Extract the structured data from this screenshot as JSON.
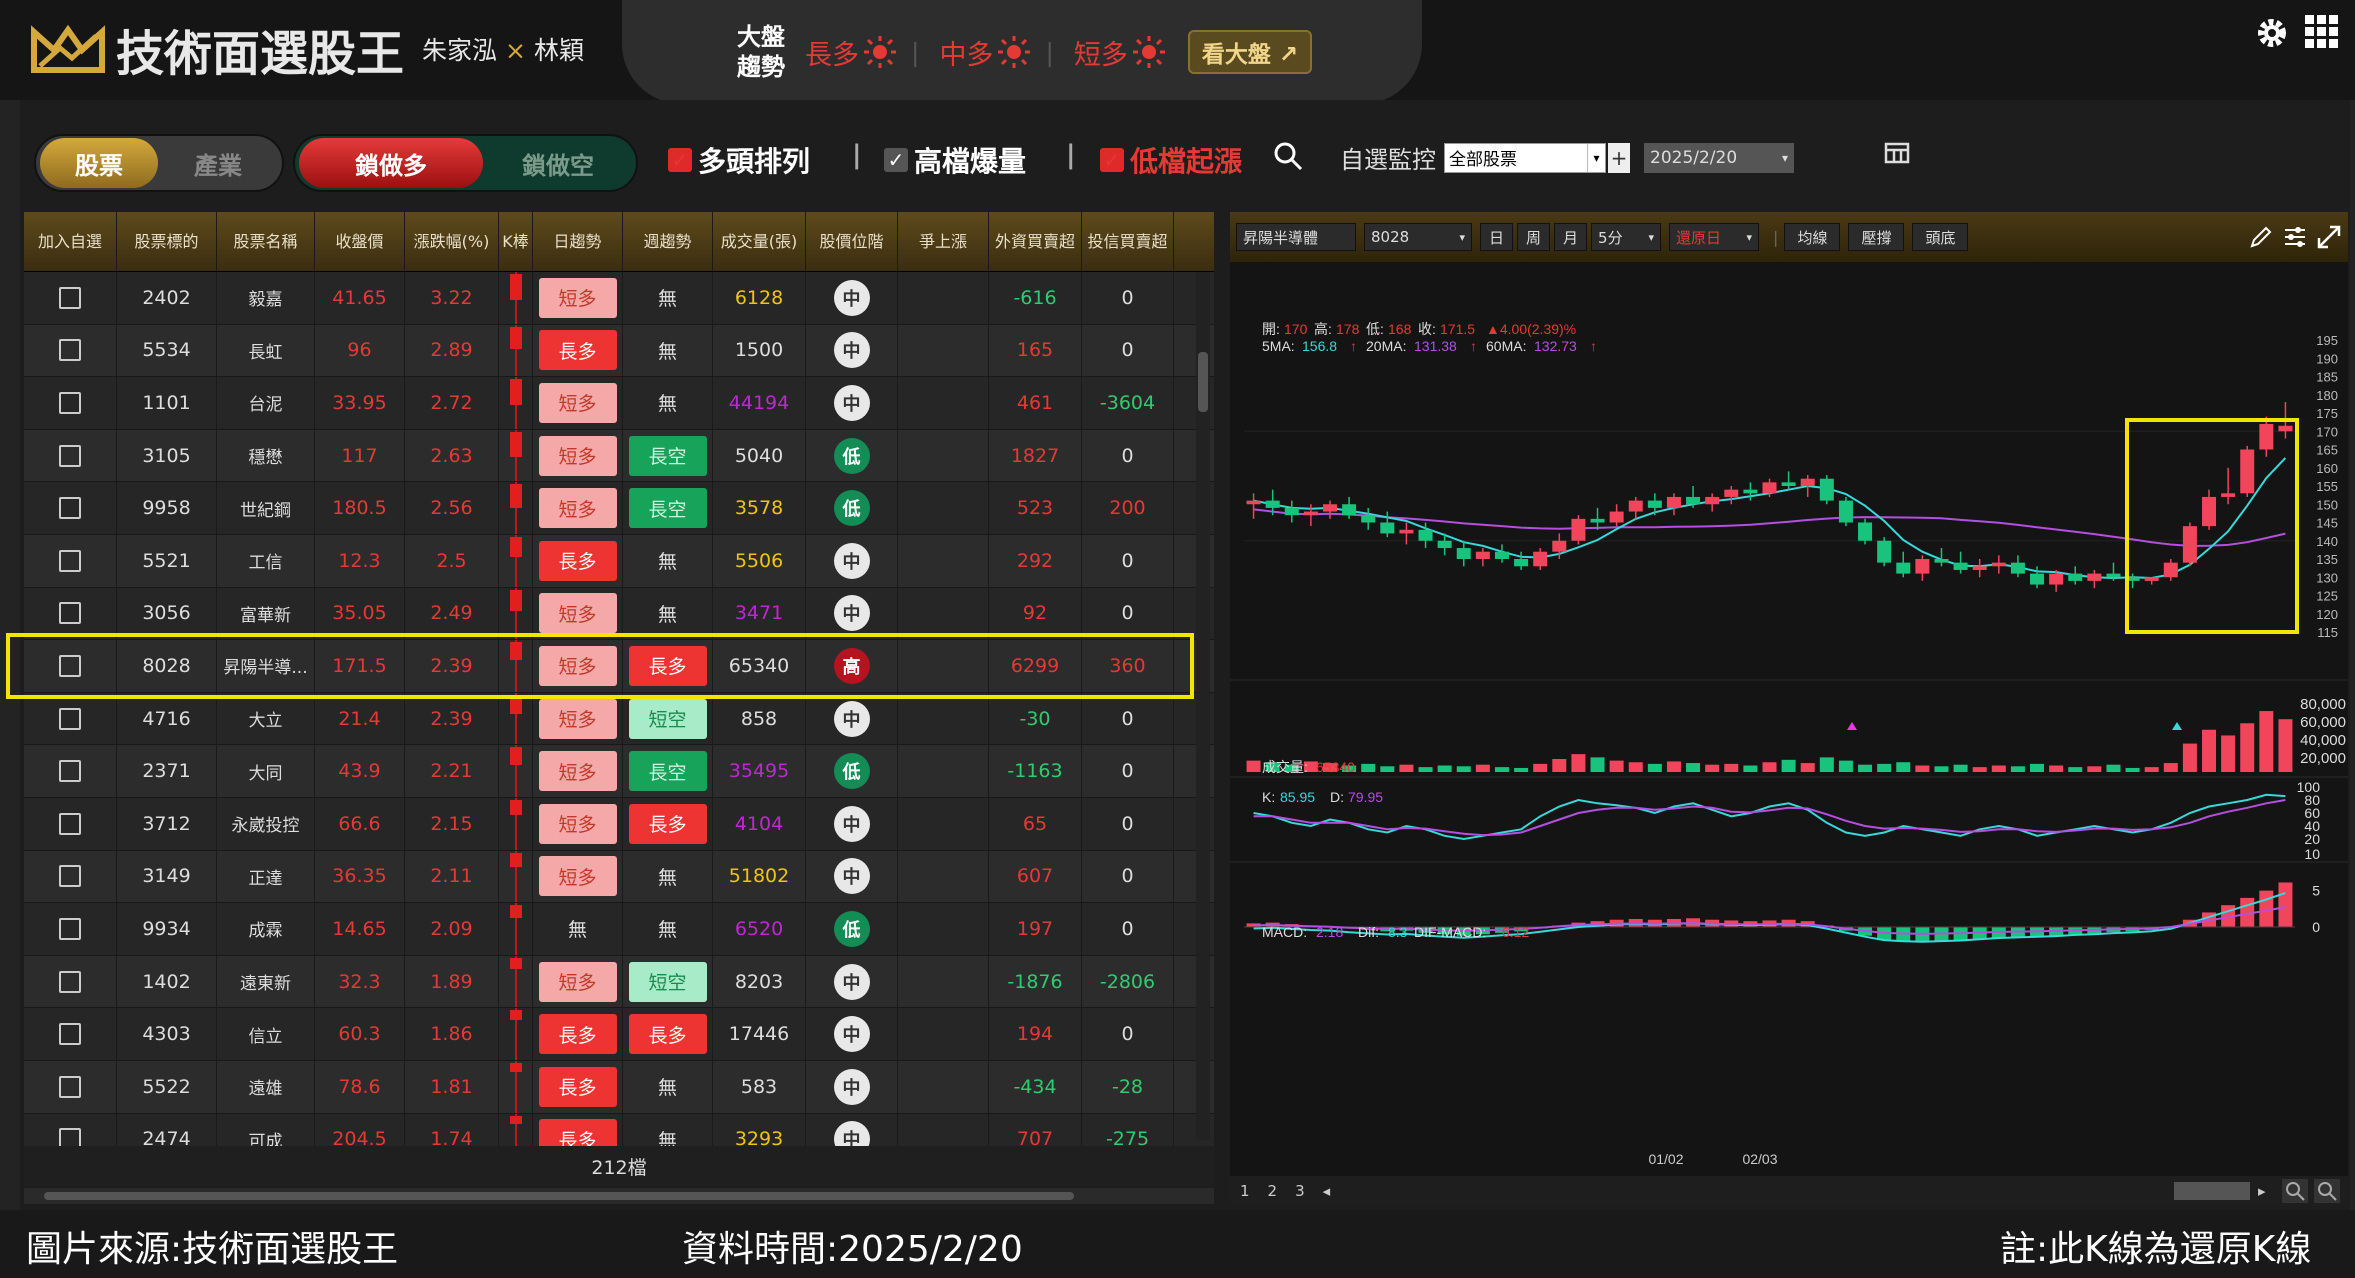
{
  "app": {
    "title": "技術面選股王",
    "author_a": "朱家泓",
    "author_sep": "×",
    "author_b": "林穎"
  },
  "market": {
    "label_line1": "大盤",
    "label_line2": "趨勢",
    "long": "長多",
    "mid": "中多",
    "short": "短多",
    "view_button": "看大盤"
  },
  "filters": {
    "tab_stock": "股票",
    "tab_industry": "產業",
    "lock_long": "鎖做多",
    "lock_short": "鎖做空",
    "opt1": "多頭排列",
    "opt2": "高檔爆量",
    "opt3": "低檔起漲",
    "watch_label": "自選監控",
    "watch_value": "全部股票",
    "date_value": "2025/2/20"
  },
  "table": {
    "headers": [
      "加入自選",
      "股票標的",
      "股票名稱",
      "收盤價",
      "漲跌幅(%)",
      "K棒",
      "日趨勢",
      "週趨勢",
      "成交量(張)",
      "股價位階",
      "爭上漲",
      "外資買賣超",
      "投信買賣超"
    ],
    "rows": [
      {
        "code": "2402",
        "name": "毅嘉",
        "close": "41.65",
        "chg": "3.22",
        "day": "短多",
        "week": "無",
        "vol": "6128",
        "volc": "yellow",
        "pos": "中",
        "fi": "-616",
        "fic": "green",
        "it": "0",
        "itc": "white"
      },
      {
        "code": "5534",
        "name": "長虹",
        "close": "96",
        "chg": "2.89",
        "day": "長多",
        "week": "無",
        "vol": "1500",
        "volc": "white",
        "pos": "中",
        "fi": "165",
        "fic": "red",
        "it": "0",
        "itc": "white"
      },
      {
        "code": "1101",
        "name": "台泥",
        "close": "33.95",
        "chg": "2.72",
        "day": "短多",
        "week": "無",
        "vol": "44194",
        "volc": "purple",
        "pos": "中",
        "fi": "461",
        "fic": "red",
        "it": "-3604",
        "itc": "green"
      },
      {
        "code": "3105",
        "name": "穩懋",
        "close": "117",
        "chg": "2.63",
        "day": "短多",
        "week": "長空",
        "vol": "5040",
        "volc": "white",
        "pos": "低",
        "fi": "1827",
        "fic": "red",
        "it": "0",
        "itc": "white"
      },
      {
        "code": "9958",
        "name": "世紀鋼",
        "close": "180.5",
        "chg": "2.56",
        "day": "短多",
        "week": "長空",
        "vol": "3578",
        "volc": "yellow",
        "pos": "低",
        "fi": "523",
        "fic": "red",
        "it": "200",
        "itc": "red"
      },
      {
        "code": "5521",
        "name": "工信",
        "close": "12.3",
        "chg": "2.5",
        "day": "長多",
        "week": "無",
        "vol": "5506",
        "volc": "yellow",
        "pos": "中",
        "fi": "292",
        "fic": "red",
        "it": "0",
        "itc": "white"
      },
      {
        "code": "3056",
        "name": "富華新",
        "close": "35.05",
        "chg": "2.49",
        "day": "短多",
        "week": "無",
        "vol": "3471",
        "volc": "purple",
        "pos": "中",
        "fi": "92",
        "fic": "red",
        "it": "0",
        "itc": "white"
      },
      {
        "code": "8028",
        "name": "昇陽半導...",
        "close": "171.5",
        "chg": "2.39",
        "day": "短多",
        "week": "長多",
        "vol": "65340",
        "volc": "white",
        "pos": "高",
        "fi": "6299",
        "fic": "red",
        "it": "360",
        "itc": "red"
      },
      {
        "code": "4716",
        "name": "大立",
        "close": "21.4",
        "chg": "2.39",
        "day": "短多",
        "week": "短空",
        "vol": "858",
        "volc": "white",
        "pos": "中",
        "fi": "-30",
        "fic": "green",
        "it": "0",
        "itc": "white"
      },
      {
        "code": "2371",
        "name": "大同",
        "close": "43.9",
        "chg": "2.21",
        "day": "短多",
        "week": "長空",
        "vol": "35495",
        "volc": "purple",
        "pos": "低",
        "fi": "-1163",
        "fic": "green",
        "it": "0",
        "itc": "white"
      },
      {
        "code": "3712",
        "name": "永崴投控",
        "close": "66.6",
        "chg": "2.15",
        "day": "短多",
        "week": "長多",
        "vol": "4104",
        "volc": "purple",
        "pos": "中",
        "fi": "65",
        "fic": "red",
        "it": "0",
        "itc": "white"
      },
      {
        "code": "3149",
        "name": "正達",
        "close": "36.35",
        "chg": "2.11",
        "day": "短多",
        "week": "無",
        "vol": "51802",
        "volc": "yellow",
        "pos": "中",
        "fi": "607",
        "fic": "red",
        "it": "0",
        "itc": "white"
      },
      {
        "code": "9934",
        "name": "成霖",
        "close": "14.65",
        "chg": "2.09",
        "day": "無",
        "week": "無",
        "vol": "6520",
        "volc": "purple",
        "pos": "低",
        "fi": "197",
        "fic": "red",
        "it": "0",
        "itc": "white"
      },
      {
        "code": "1402",
        "name": "遠東新",
        "close": "32.3",
        "chg": "1.89",
        "day": "短多",
        "week": "短空",
        "vol": "8203",
        "volc": "white",
        "pos": "中",
        "fi": "-1876",
        "fic": "green",
        "it": "-2806",
        "itc": "green"
      },
      {
        "code": "4303",
        "name": "信立",
        "close": "60.3",
        "chg": "1.86",
        "day": "長多",
        "week": "長多",
        "vol": "17446",
        "volc": "white",
        "pos": "中",
        "fi": "194",
        "fic": "red",
        "it": "0",
        "itc": "white"
      },
      {
        "code": "5522",
        "name": "遠雄",
        "close": "78.6",
        "chg": "1.81",
        "day": "長多",
        "week": "無",
        "vol": "583",
        "volc": "white",
        "pos": "中",
        "fi": "-434",
        "fic": "green",
        "it": "-28",
        "itc": "green"
      },
      {
        "code": "2474",
        "name": "可成",
        "close": "204.5",
        "chg": "1.74",
        "day": "長多",
        "week": "無",
        "vol": "3293",
        "volc": "yellow",
        "pos": "中",
        "fi": "707",
        "fic": "red",
        "it": "-275",
        "itc": "green"
      }
    ],
    "count": "212檔"
  },
  "chart_toolbar": {
    "name": "昇陽半導體",
    "code": "8028",
    "day": "日",
    "week": "周",
    "month": "月",
    "interval": "5分",
    "adjust": "還原日",
    "ma_btn": "均線",
    "press_btn": "壓撐",
    "top_btn": "頭底"
  },
  "chart_info": {
    "open_label": "開:",
    "open": "170",
    "high_label": "高:",
    "high": "178",
    "low_label": "低:",
    "low": "168",
    "close_label": "收:",
    "close": "171.5",
    "change": "▲4.00(2.39)%",
    "ma5_label": "5MA:",
    "ma5": "156.8",
    "ma20_label": "20MA:",
    "ma20": "131.38",
    "ma60_label": "60MA:",
    "ma60": "132.73",
    "vol_label": "成交量:",
    "vol": "65340",
    "k_label": "K:",
    "k": "85.95",
    "d_label": "D:",
    "d": "79.95",
    "macd_label": "MACD:",
    "macd": "2.18",
    "dif_label": "Dif:",
    "dif": "8.3",
    "difmacd_label": "DIF-MACD:",
    "difmacd": "6.12",
    "date1": "01/02",
    "date2": "02/03",
    "price_ticks": [
      "195",
      "190",
      "185",
      "180",
      "175",
      "170",
      "165",
      "160",
      "155",
      "150",
      "145",
      "140",
      "135",
      "130",
      "125",
      "120",
      "115"
    ],
    "vol_ticks": [
      "80,000",
      "60,000",
      "40,000",
      "20,000"
    ],
    "kd_ticks": [
      "100",
      "80",
      "60",
      "40",
      "20"
    ],
    "macd_ticks": [
      "10",
      "5",
      "0"
    ],
    "pages": [
      "1",
      "2",
      "3"
    ]
  },
  "chart_data": {
    "type": "candlestick",
    "series": [
      {
        "o": 150,
        "h": 153,
        "l": 146,
        "c": 151
      },
      {
        "o": 151,
        "h": 154,
        "l": 147,
        "c": 149
      },
      {
        "o": 149,
        "h": 151,
        "l": 145,
        "c": 147
      },
      {
        "o": 147,
        "h": 150,
        "l": 144,
        "c": 148
      },
      {
        "o": 148,
        "h": 151,
        "l": 146,
        "c": 150
      },
      {
        "o": 150,
        "h": 152,
        "l": 146,
        "c": 147
      },
      {
        "o": 147,
        "h": 149,
        "l": 143,
        "c": 145
      },
      {
        "o": 145,
        "h": 148,
        "l": 141,
        "c": 142
      },
      {
        "o": 142,
        "h": 145,
        "l": 139,
        "c": 143
      },
      {
        "o": 143,
        "h": 145,
        "l": 138,
        "c": 140
      },
      {
        "o": 140,
        "h": 142,
        "l": 136,
        "c": 138
      },
      {
        "o": 138,
        "h": 140,
        "l": 133,
        "c": 135
      },
      {
        "o": 135,
        "h": 138,
        "l": 133,
        "c": 137
      },
      {
        "o": 137,
        "h": 139,
        "l": 134,
        "c": 135
      },
      {
        "o": 135,
        "h": 137,
        "l": 132,
        "c": 133
      },
      {
        "o": 133,
        "h": 138,
        "l": 132,
        "c": 137
      },
      {
        "o": 137,
        "h": 142,
        "l": 135,
        "c": 140
      },
      {
        "o": 140,
        "h": 147,
        "l": 139,
        "c": 146
      },
      {
        "o": 146,
        "h": 149,
        "l": 143,
        "c": 145
      },
      {
        "o": 145,
        "h": 150,
        "l": 144,
        "c": 148
      },
      {
        "o": 148,
        "h": 152,
        "l": 146,
        "c": 151
      },
      {
        "o": 151,
        "h": 153,
        "l": 147,
        "c": 149
      },
      {
        "o": 149,
        "h": 153,
        "l": 147,
        "c": 152
      },
      {
        "o": 152,
        "h": 155,
        "l": 149,
        "c": 150
      },
      {
        "o": 150,
        "h": 153,
        "l": 148,
        "c": 152
      },
      {
        "o": 152,
        "h": 155,
        "l": 150,
        "c": 154
      },
      {
        "o": 154,
        "h": 156,
        "l": 151,
        "c": 153
      },
      {
        "o": 153,
        "h": 157,
        "l": 152,
        "c": 156
      },
      {
        "o": 156,
        "h": 159,
        "l": 154,
        "c": 155
      },
      {
        "o": 155,
        "h": 158,
        "l": 152,
        "c": 157
      },
      {
        "o": 157,
        "h": 158,
        "l": 150,
        "c": 151
      },
      {
        "o": 151,
        "h": 152,
        "l": 144,
        "c": 145
      },
      {
        "o": 145,
        "h": 146,
        "l": 139,
        "c": 140
      },
      {
        "o": 140,
        "h": 141,
        "l": 133,
        "c": 134
      },
      {
        "o": 134,
        "h": 137,
        "l": 130,
        "c": 131
      },
      {
        "o": 131,
        "h": 136,
        "l": 129,
        "c": 135
      },
      {
        "o": 135,
        "h": 138,
        "l": 133,
        "c": 134
      },
      {
        "o": 134,
        "h": 137,
        "l": 131,
        "c": 132
      },
      {
        "o": 132,
        "h": 135,
        "l": 130,
        "c": 133
      },
      {
        "o": 133,
        "h": 136,
        "l": 131,
        "c": 134
      },
      {
        "o": 134,
        "h": 136,
        "l": 130,
        "c": 131
      },
      {
        "o": 131,
        "h": 133,
        "l": 127,
        "c": 128
      },
      {
        "o": 128,
        "h": 132,
        "l": 126,
        "c": 131
      },
      {
        "o": 131,
        "h": 133,
        "l": 128,
        "c": 129
      },
      {
        "o": 129,
        "h": 132,
        "l": 127,
        "c": 131
      },
      {
        "o": 131,
        "h": 134,
        "l": 129,
        "c": 130
      },
      {
        "o": 130,
        "h": 131,
        "l": 127,
        "c": 129
      },
      {
        "o": 129,
        "h": 130,
        "l": 128,
        "c": 130
      },
      {
        "o": 130,
        "h": 135,
        "l": 129,
        "c": 134
      },
      {
        "o": 134,
        "h": 145,
        "l": 133,
        "c": 144
      },
      {
        "o": 144,
        "h": 154,
        "l": 143,
        "c": 152
      },
      {
        "o": 152,
        "h": 160,
        "l": 150,
        "c": 153
      },
      {
        "o": 153,
        "h": 166,
        "l": 152,
        "c": 165
      },
      {
        "o": 165,
        "h": 174,
        "l": 163,
        "c": 172
      },
      {
        "o": 170,
        "h": 178,
        "l": 168,
        "c": 171.5
      }
    ],
    "ylim": [
      115,
      195
    ],
    "volume": [
      14,
      12,
      9,
      13,
      11,
      8,
      10,
      7,
      9,
      6,
      8,
      7,
      9,
      6,
      5,
      10,
      16,
      22,
      18,
      14,
      12,
      10,
      13,
      11,
      9,
      10,
      8,
      12,
      15,
      11,
      18,
      14,
      9,
      10,
      12,
      8,
      7,
      9,
      6,
      8,
      7,
      10,
      8,
      6,
      7,
      9,
      5,
      6,
      11,
      35,
      52,
      45,
      60,
      75,
      65
    ],
    "vol_ylim": [
      0,
      80000
    ],
    "k": [
      60,
      55,
      45,
      40,
      50,
      45,
      35,
      30,
      40,
      35,
      25,
      20,
      25,
      30,
      35,
      55,
      70,
      80,
      75,
      72,
      68,
      60,
      70,
      75,
      65,
      55,
      60,
      70,
      75,
      65,
      45,
      30,
      25,
      30,
      40,
      35,
      30,
      25,
      35,
      40,
      35,
      25,
      30,
      35,
      40,
      35,
      30,
      35,
      45,
      60,
      70,
      75,
      80,
      88,
      86
    ],
    "d": [
      55,
      55,
      50,
      45,
      45,
      45,
      40,
      35,
      37,
      36,
      32,
      28,
      26,
      27,
      30,
      40,
      50,
      60,
      65,
      68,
      68,
      65,
      67,
      70,
      68,
      62,
      61,
      64,
      68,
      67,
      58,
      48,
      40,
      36,
      37,
      36,
      34,
      31,
      32,
      35,
      35,
      32,
      31,
      33,
      36,
      36,
      34,
      35,
      38,
      45,
      55,
      62,
      68,
      75,
      80
    ],
    "macd_hist": [
      0.5,
      0.6,
      0.4,
      0.2,
      0.1,
      -0.2,
      -0.4,
      -0.6,
      -0.5,
      -0.8,
      -1,
      -1.2,
      -1,
      -0.8,
      -0.6,
      -0.2,
      0.2,
      0.6,
      0.8,
      1,
      1.1,
      1,
      1.1,
      1.2,
      1,
      0.9,
      0.8,
      0.9,
      1,
      0.8,
      0.2,
      -0.5,
      -1.2,
      -1.8,
      -2,
      -2.1,
      -2,
      -1.9,
      -1.7,
      -1.5,
      -1.4,
      -1.3,
      -1.2,
      -1,
      -0.9,
      -0.7,
      -0.6,
      -0.4,
      0,
      1,
      2,
      3,
      4,
      5,
      6.12
    ]
  }
}
